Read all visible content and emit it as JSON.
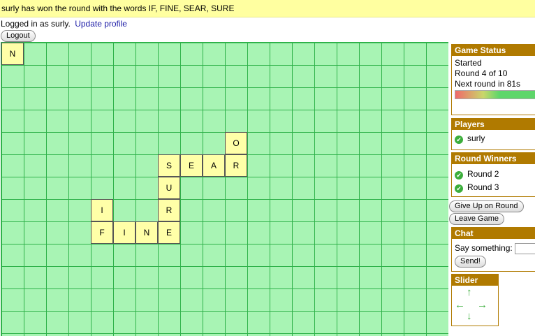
{
  "banner": {
    "message": "surly has won the round with the words IF, FINE, SEAR, SURE"
  },
  "account": {
    "logged_in_text": "Logged in as surly.",
    "update_profile_link": "Update profile",
    "logout_label": "Logout"
  },
  "board": {
    "tiles": [
      {
        "letter": "N",
        "col": 0,
        "row": 0
      },
      {
        "letter": "O",
        "col": 10,
        "row": 4
      },
      {
        "letter": "S",
        "col": 7,
        "row": 5
      },
      {
        "letter": "E",
        "col": 8,
        "row": 5
      },
      {
        "letter": "A",
        "col": 9,
        "row": 5
      },
      {
        "letter": "R",
        "col": 10,
        "row": 5
      },
      {
        "letter": "U",
        "col": 7,
        "row": 6
      },
      {
        "letter": "I",
        "col": 4,
        "row": 7
      },
      {
        "letter": "R",
        "col": 7,
        "row": 7
      },
      {
        "letter": "F",
        "col": 4,
        "row": 8
      },
      {
        "letter": "I",
        "col": 5,
        "row": 8
      },
      {
        "letter": "N",
        "col": 6,
        "row": 8
      },
      {
        "letter": "E",
        "col": 7,
        "row": 8
      }
    ]
  },
  "game_status": {
    "title": "Game Status",
    "state": "Started",
    "round": "Round 4 of 10",
    "next_round": "Next round in 81s",
    "timer_fraction": 0.3
  },
  "players": {
    "title": "Players",
    "items": [
      {
        "name": "surly"
      }
    ]
  },
  "round_winners": {
    "title": "Round Winners",
    "items": [
      {
        "label": "Round 2"
      },
      {
        "label": "Round 3"
      }
    ]
  },
  "actions": {
    "give_up_label": "Give Up on Round",
    "leave_label": "Leave Game"
  },
  "chat": {
    "title": "Chat",
    "prompt": "Say something:",
    "input_value": "",
    "send_label": "Send!"
  },
  "slider": {
    "title": "Slider",
    "arrows": {
      "up": "↑",
      "down": "↓",
      "left": "←",
      "right": "→"
    },
    "icon_color": "#3cae3c"
  },
  "colors": {
    "board_bg": "#a8f4b4",
    "grid_line": "#2fb24a",
    "tile_bg": "#ffffa8",
    "panel_header": "#b07a00",
    "banner_bg": "#ffffa0"
  }
}
